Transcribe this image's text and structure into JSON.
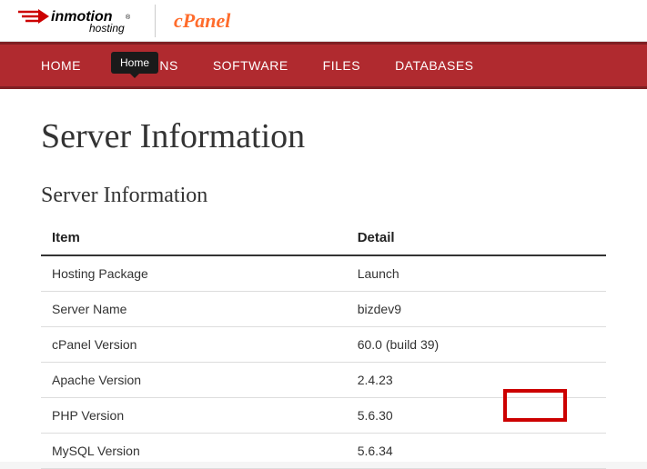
{
  "header": {
    "brand_main": "inmotion",
    "brand_sub": "hosting",
    "partner_brand": "cPanel"
  },
  "nav": {
    "items": [
      "HOME",
      "DOMAINS",
      "SOFTWARE",
      "FILES",
      "DATABASES"
    ],
    "tooltip_label": "Home"
  },
  "page": {
    "title": "Server Information",
    "section_title": "Server Information"
  },
  "table": {
    "headers": {
      "item": "Item",
      "detail": "Detail"
    },
    "rows": [
      {
        "item": "Hosting Package",
        "detail": "Launch"
      },
      {
        "item": "Server Name",
        "detail": "bizdev9"
      },
      {
        "item": "cPanel Version",
        "detail": "60.0 (build 39)"
      },
      {
        "item": "Apache Version",
        "detail": "2.4.23"
      },
      {
        "item": "PHP Version",
        "detail": "5.6.30"
      },
      {
        "item": "MySQL Version",
        "detail": "5.6.34"
      }
    ]
  }
}
